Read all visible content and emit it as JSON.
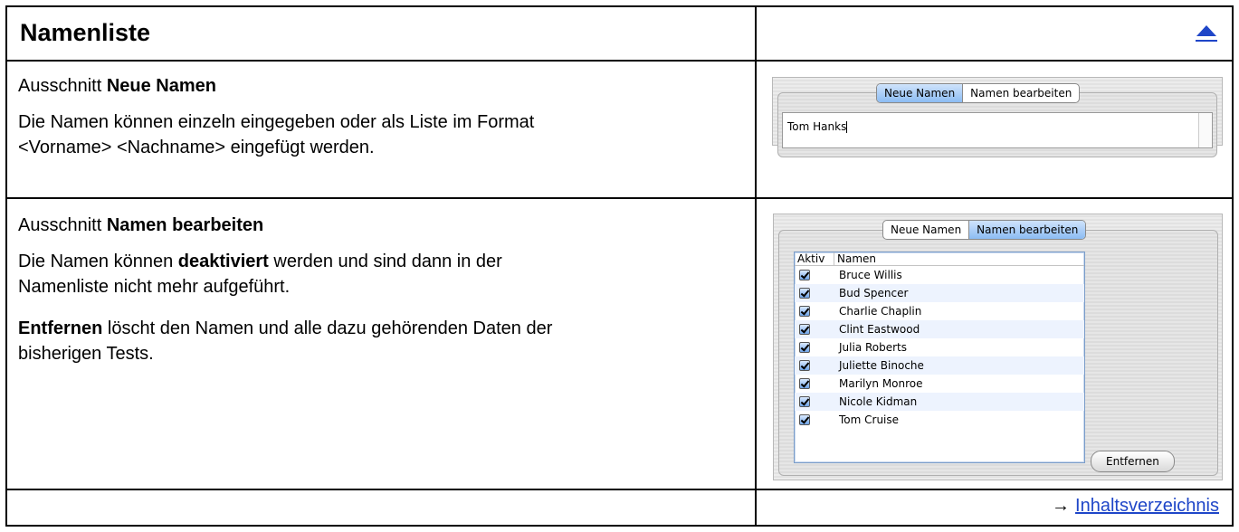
{
  "header": {
    "title": "Namenliste",
    "up_link_icon": "triangle-up-icon",
    "link_color": "#1f46c8"
  },
  "section_new": {
    "heading_prefix": "Ausschnitt",
    "heading_bold": "Neue Namen",
    "desc_line1": "Die Namen können einzeln eingegeben oder als Liste im Format",
    "desc_line2": "<Vorname> <Nachname> eingefügt werden.",
    "screenshot": {
      "tabs": [
        "Neue Namen",
        "Namen bearbeiten"
      ],
      "selected_tab": "Neue Namen",
      "textarea_value": "Tom Hanks"
    }
  },
  "section_edit": {
    "heading_prefix": "Ausschnitt",
    "heading_bold": "Namen bearbeiten",
    "p1_before": "Die Namen können",
    "p1_bold": "deaktiviert",
    "p1_after_line1": "werden und sind dann in der",
    "p1_line2": "Namenliste nicht mehr aufgeführt.",
    "p2_bold": "Entfernen",
    "p2_after_line1": "löscht den Namen und alle dazu gehörenden Daten der",
    "p2_line2": "bisherigen Tests.",
    "screenshot": {
      "tabs": [
        "Neue Namen",
        "Namen bearbeiten"
      ],
      "selected_tab": "Namen bearbeiten",
      "columns": [
        "Aktiv",
        "Namen"
      ],
      "rows": [
        {
          "aktiv": true,
          "name": "Bruce Willis"
        },
        {
          "aktiv": true,
          "name": "Bud Spencer"
        },
        {
          "aktiv": true,
          "name": "Charlie Chaplin"
        },
        {
          "aktiv": true,
          "name": "Clint Eastwood"
        },
        {
          "aktiv": true,
          "name": "Julia Roberts"
        },
        {
          "aktiv": true,
          "name": "Juliette Binoche"
        },
        {
          "aktiv": true,
          "name": "Marilyn Monroe"
        },
        {
          "aktiv": true,
          "name": "Nicole Kidman"
        },
        {
          "aktiv": true,
          "name": "Tom Cruise"
        }
      ],
      "remove_button": "Entfernen"
    }
  },
  "footer": {
    "arrow": "→",
    "toc_link": "Inhaltsverzeichnis"
  }
}
